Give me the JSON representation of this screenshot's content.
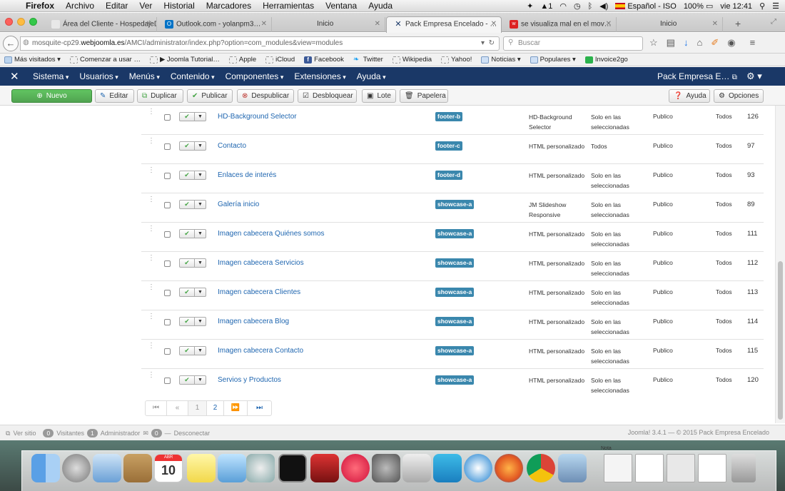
{
  "mac_menubar": {
    "app": "Firefox",
    "items": [
      "Archivo",
      "Editar",
      "Ver",
      "Historial",
      "Marcadores",
      "Herramientas",
      "Ventana",
      "Ayuda"
    ],
    "status": {
      "keyboard": "Español - ISO",
      "battery": "100%",
      "clock": "vie 12:41",
      "notification_count": "1"
    }
  },
  "tabs": [
    {
      "label": "Área del Cliente - HospedajeD…"
    },
    {
      "label": "Outlook.com - yolanpm3…"
    },
    {
      "label": "Inicio"
    },
    {
      "label": "Pack Empresa Encelado - …",
      "active": true
    },
    {
      "label": "se visualiza mal en el mov…"
    },
    {
      "label": "Inicio"
    }
  ],
  "navbar": {
    "url_prefix": "mosquite-cp29.",
    "url_domain": "webjoomla.es",
    "url_rest": "/AMCI/administrator/index.php?option=com_modules&view=modules",
    "search_placeholder": "Buscar"
  },
  "bookmarks": [
    {
      "label": "Más visitados ▾",
      "icon": "gear-icon"
    },
    {
      "label": "Comenzar a usar …",
      "icon": "page-icon"
    },
    {
      "label": "▶ Joomla Tutorial…",
      "icon": "page-icon"
    },
    {
      "label": "Apple",
      "icon": "page-icon"
    },
    {
      "label": "iCloud",
      "icon": "page-icon"
    },
    {
      "label": "Facebook",
      "icon": "facebook-icon"
    },
    {
      "label": "Twitter",
      "icon": "twitter-icon"
    },
    {
      "label": "Wikipedia",
      "icon": "page-icon"
    },
    {
      "label": "Yahoo!",
      "icon": "page-icon"
    },
    {
      "label": "Noticias ▾",
      "icon": "folder-icon"
    },
    {
      "label": "Populares ▾",
      "icon": "folder-icon"
    },
    {
      "label": "Invoice2go",
      "icon": "invoice-icon"
    }
  ],
  "joomla_nav": {
    "menu": [
      "Sistema",
      "Usuarios",
      "Menús",
      "Contenido",
      "Componentes",
      "Extensiones",
      "Ayuda"
    ],
    "site_name": "Pack Empresa E…"
  },
  "toolbar": {
    "nuevo": "Nuevo",
    "editar": "Editar",
    "duplicar": "Duplicar",
    "publicar": "Publicar",
    "despublicar": "Despublicar",
    "desbloquear": "Desbloquear",
    "lote": "Lote",
    "papelera": "Papelera",
    "ayuda": "Ayuda",
    "opciones": "Opciones"
  },
  "modules": [
    {
      "title": "HD-Background Selector",
      "position": "footer-b",
      "type": "HD-Background Selector",
      "pages": "Solo en las seleccionadas",
      "access": "Publico",
      "language": "Todos",
      "id": "126"
    },
    {
      "title": "Contacto",
      "position": "footer-c",
      "type": "HTML personalizado",
      "pages": "Todos",
      "access": "Publico",
      "language": "Todos",
      "id": "97"
    },
    {
      "title": "Enlaces de interés",
      "position": "footer-d",
      "type": "HTML personalizado",
      "pages": "Solo en las seleccionadas",
      "access": "Publico",
      "language": "Todos",
      "id": "93"
    },
    {
      "title": "Galería inicio",
      "position": "showcase-a",
      "type": "JM Slideshow Responsive",
      "pages": "Solo en las seleccionadas",
      "access": "Publico",
      "language": "Todos",
      "id": "89"
    },
    {
      "title": "Imagen cabecera Quiénes somos",
      "position": "showcase-a",
      "type": "HTML personalizado",
      "pages": "Solo en las seleccionadas",
      "access": "Publico",
      "language": "Todos",
      "id": "111"
    },
    {
      "title": "Imagen cabecera Servicios",
      "position": "showcase-a",
      "type": "HTML personalizado",
      "pages": "Solo en las seleccionadas",
      "access": "Publico",
      "language": "Todos",
      "id": "112"
    },
    {
      "title": "Imagen cabecera Clientes",
      "position": "showcase-a",
      "type": "HTML personalizado",
      "pages": "Solo en las seleccionadas",
      "access": "Publico",
      "language": "Todos",
      "id": "113"
    },
    {
      "title": "Imagen cabecera Blog",
      "position": "showcase-a",
      "type": "HTML personalizado",
      "pages": "Solo en las seleccionadas",
      "access": "Publico",
      "language": "Todos",
      "id": "114"
    },
    {
      "title": "Imagen cabecera Contacto",
      "position": "showcase-a",
      "type": "HTML personalizado",
      "pages": "Solo en las seleccionadas",
      "access": "Publico",
      "language": "Todos",
      "id": "115"
    },
    {
      "title": "Servios y Productos",
      "position": "showcase-a",
      "type": "HTML personalizado",
      "pages": "Solo en las seleccionadas",
      "access": "Publico",
      "language": "Todos",
      "id": "120"
    }
  ],
  "pagination": {
    "pages": [
      "1",
      "2"
    ],
    "current": "1"
  },
  "status_bar": {
    "ver_sitio": "Ver sitio",
    "visitantes_count": "0",
    "visitantes": "Visitantes",
    "admin_count": "1",
    "administrador": "Administrador",
    "msg_count": "0",
    "desconectar": "Desconectar",
    "copyright": "Joomla! 3.4.1  —  © 2015 Pack Empresa Encelado"
  },
  "dock": {
    "calendar_day": "10",
    "calendar_month": "ABR",
    "note_label": "Nota"
  },
  "colors": {
    "joomla_nav": "#1a3867",
    "link": "#1f66b0",
    "position_badge": "#3a87ad",
    "new_button": "#51a351"
  }
}
